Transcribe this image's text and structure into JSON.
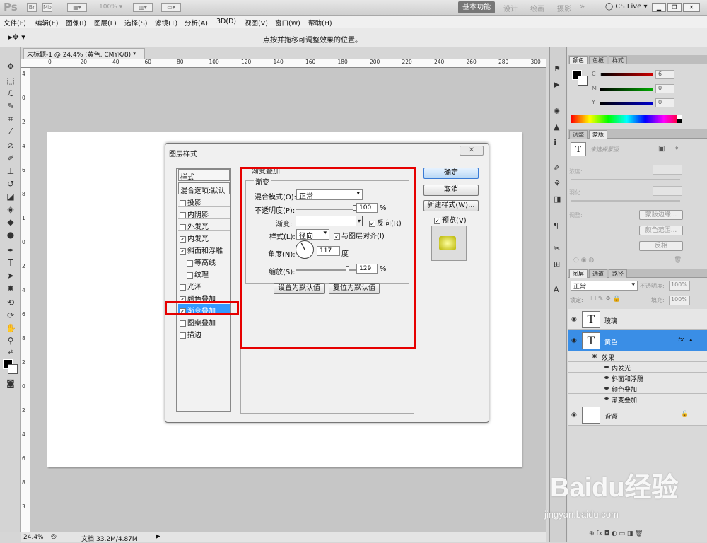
{
  "app": {
    "logo": "Ps",
    "zoom": "100%"
  },
  "workspace": {
    "active": "基本功能",
    "others": [
      "设计",
      "绘画",
      "摄影"
    ],
    "more": "»",
    "cslive": "CS Live"
  },
  "menu": [
    "文件(F)",
    "编辑(E)",
    "图像(I)",
    "图层(L)",
    "选择(S)",
    "滤镜(T)",
    "分析(A)",
    "3D(D)",
    "视图(V)",
    "窗口(W)",
    "帮助(H)"
  ],
  "options": {
    "hint": "点按并拖移可调整效果的位置。"
  },
  "document": {
    "tab_title": "未标题-1 @ 24.4% (黄色, CMYK/8) *"
  },
  "ruler_h": [
    "0",
    "20",
    "40",
    "60",
    "80",
    "100",
    "120",
    "140",
    "160",
    "180",
    "200",
    "220",
    "240",
    "260",
    "280",
    "300"
  ],
  "ruler_v": [
    "4",
    "0",
    "2",
    "4",
    "6",
    "8",
    "1",
    "0",
    "2",
    "4",
    "6",
    "8",
    "2",
    "0",
    "2",
    "4",
    "6",
    "8",
    "3"
  ],
  "status": {
    "zoom": "24.4%",
    "doc": "文档:33.2M/4.87M"
  },
  "color_panel": {
    "tabs": [
      "颜色",
      "色板",
      "样式"
    ],
    "c": "6",
    "m": "0",
    "y": "0",
    "labels": [
      "C",
      "M",
      "Y"
    ]
  },
  "adjust_panel": {
    "tabs": [
      "调整",
      "蒙版"
    ],
    "no_mask": "未选择蒙版",
    "density": "浓度:",
    "feather": "羽化:",
    "refine": "调整:",
    "btn_edge": "蒙版边缘...",
    "btn_range": "颜色范围...",
    "btn_invert": "反相"
  },
  "layers_panel": {
    "tabs": [
      "图层",
      "通道",
      "路径"
    ],
    "blend": "正常",
    "opacity_label": "不透明度:",
    "opacity": "100%",
    "lock_label": "锁定:",
    "fill_label": "填充:",
    "fill": "100%",
    "layers": [
      {
        "name": "玻璃",
        "thumb": "T"
      },
      {
        "name": "黄色",
        "thumb": "T",
        "fx": "fx"
      },
      {
        "name": "背景",
        "thumb": ""
      }
    ],
    "effects_label": "效果",
    "effects": [
      "内发光",
      "斜面和浮雕",
      "颜色叠加",
      "渐变叠加"
    ]
  },
  "dialog": {
    "title": "图层样式",
    "styles_header": "样式",
    "blend_default": "混合选项:默认",
    "items": [
      {
        "label": "投影",
        "checked": false
      },
      {
        "label": "内阴影",
        "checked": false
      },
      {
        "label": "外发光",
        "checked": false
      },
      {
        "label": "内发光",
        "checked": true
      },
      {
        "label": "斜面和浮雕",
        "checked": true
      },
      {
        "label": "等高线",
        "checked": false
      },
      {
        "label": "纹理",
        "checked": false
      },
      {
        "label": "光泽",
        "checked": false
      },
      {
        "label": "颜色叠加",
        "checked": true
      },
      {
        "label": "渐变叠加",
        "checked": true
      },
      {
        "label": "图案叠加",
        "checked": false
      },
      {
        "label": "描边",
        "checked": false
      }
    ],
    "section_title": "渐变叠加",
    "group_title": "渐变",
    "blend_mode_label": "混合模式(O):",
    "blend_mode": "正常",
    "opacity_label": "不透明度(P):",
    "opacity": "100",
    "opacity_fraction": 1.0,
    "pct": "%",
    "gradient_label": "渐变:",
    "reverse_label": "反向(R)",
    "style_label": "样式(L):",
    "style": "径向",
    "align_label": "与图层对齐(I)",
    "angle_label": "角度(N):",
    "angle": "117",
    "degree": "度",
    "scale_label": "缩放(S):",
    "scale": "129",
    "scale_fraction": 0.86,
    "btn_default": "设置为默认值",
    "btn_reset": "复位为默认值",
    "ok": "确定",
    "cancel": "取消",
    "new_style": "新建样式(W)...",
    "preview": "预览(V)"
  },
  "watermark": {
    "brand": "Baidu经验",
    "url": "jingyan.baidu.com"
  }
}
